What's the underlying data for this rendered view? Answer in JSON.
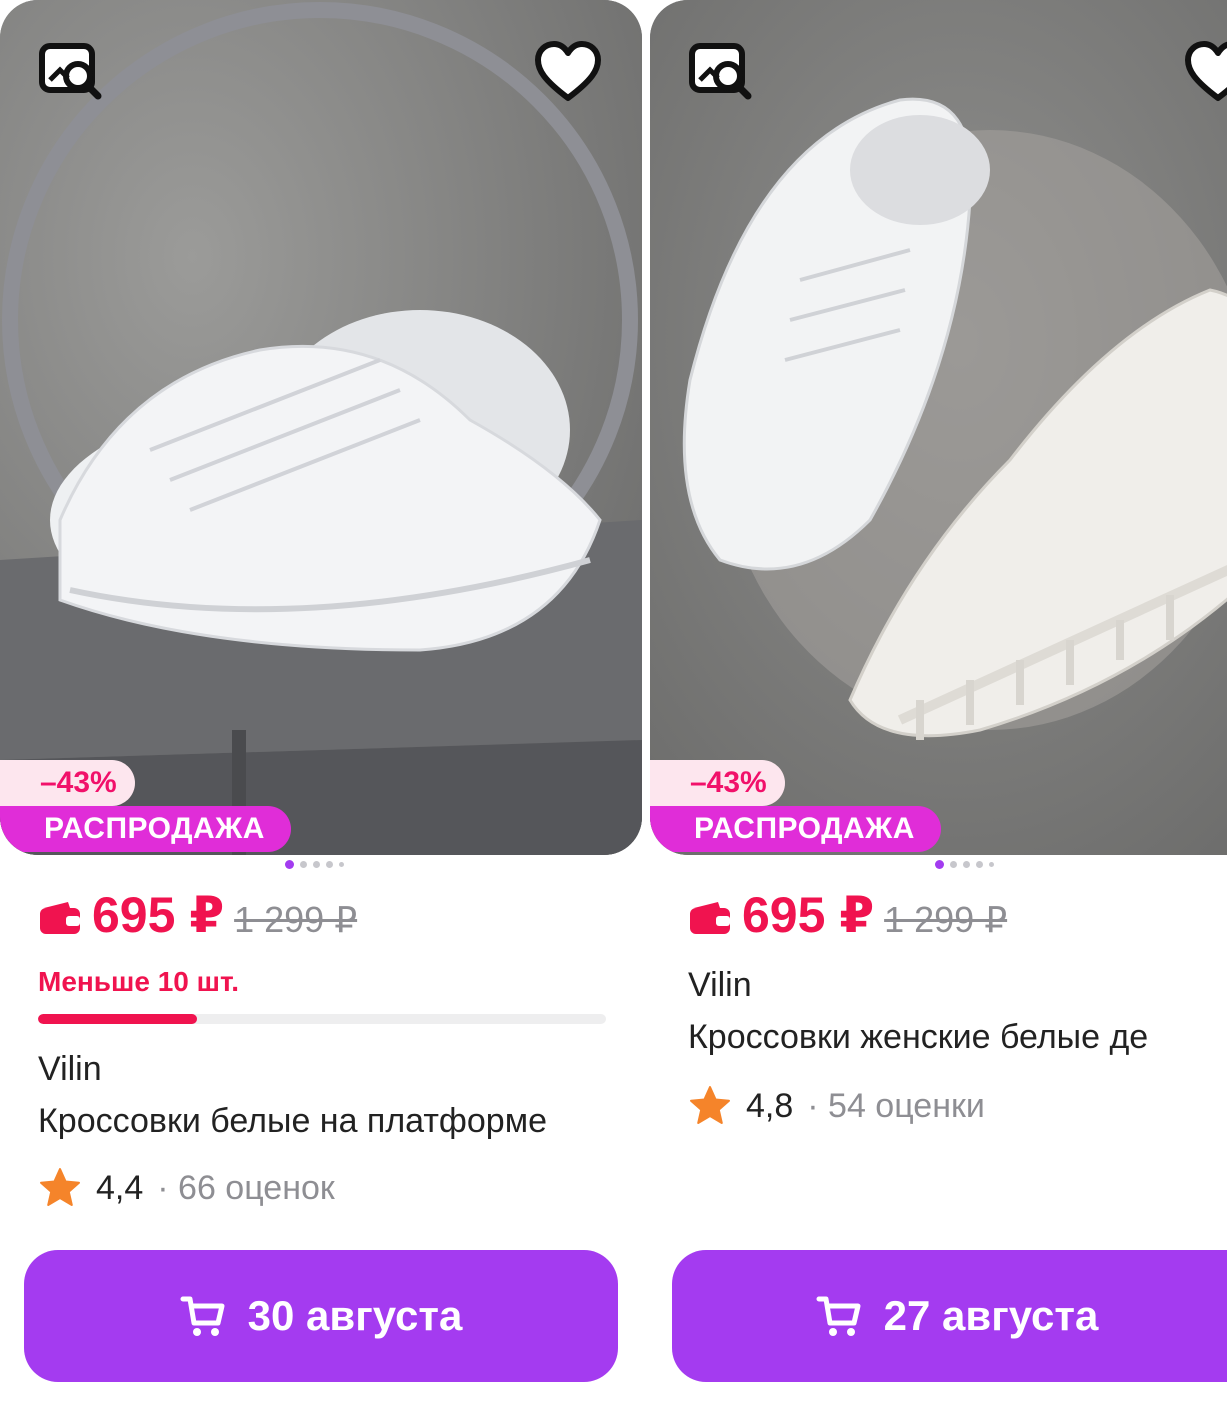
{
  "colors": {
    "accent": "#a43bf0",
    "price": "#f0134f",
    "sale_badge": "#e02dd8",
    "star": "#f5842a"
  },
  "icons": {
    "search_by_image": "image-search-icon",
    "favorite": "heart-icon",
    "wallet": "wallet-icon",
    "cart": "cart-icon",
    "star": "star-icon"
  },
  "products": [
    {
      "discount": "–43%",
      "sale_label": "РАСПРОДАЖА",
      "price": "695 ₽",
      "old_price": "1 299 ₽",
      "stock_text": "Меньше 10 шт.",
      "stock_level": 0.28,
      "brand": "Vilin",
      "title": "Кроссовки белые на платформе",
      "rating": "4,4",
      "reviews": "· 66 оценок",
      "delivery": "30 августа",
      "photo_count": 5,
      "photo_index": 1
    },
    {
      "discount": "–43%",
      "sale_label": "РАСПРОДАЖА",
      "price": "695 ₽",
      "old_price": "1 299 ₽",
      "brand": "Vilin",
      "title": "Кроссовки женские белые де",
      "rating": "4,8",
      "reviews": "· 54 оценки",
      "delivery": "27 августа",
      "photo_count": 5,
      "photo_index": 1
    }
  ]
}
